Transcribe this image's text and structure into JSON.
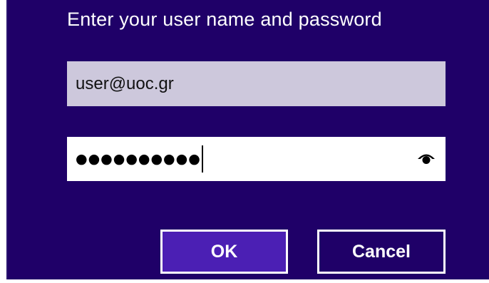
{
  "dialog": {
    "title": "Enter your user name and password",
    "username_value": "user@uoc.gr",
    "password_mask": "●●●●●●●●●●",
    "reveal_icon": "eye-reveal-icon",
    "ok_label": "OK",
    "cancel_label": "Cancel"
  },
  "colors": {
    "dialog_background": "#1f0068",
    "ok_button": "#4b1fb4",
    "username_field": "#cdc8dc",
    "text_light": "#ffffff"
  }
}
